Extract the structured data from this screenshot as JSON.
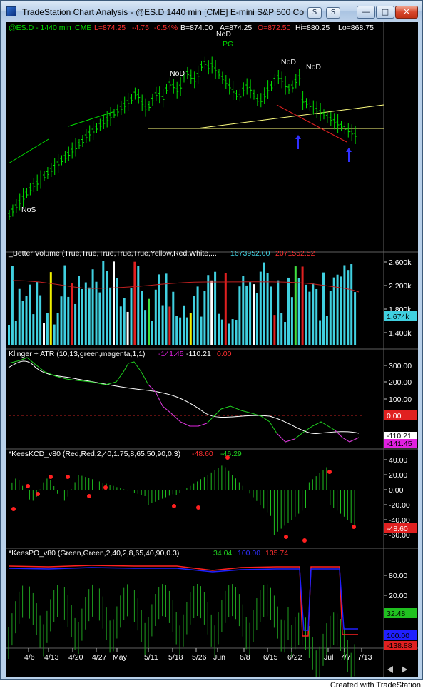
{
  "window": {
    "title": "TradeStation Chart Analysis - @ES.D 1440 min [CME] E-mini S&P 500 Co...",
    "buttons": {
      "s1": "S",
      "s2": "S"
    },
    "caption": {
      "minimize": "—",
      "maximize": "□",
      "close": "✕"
    }
  },
  "status": {
    "credit": "Created with TradeStation"
  },
  "price_panel": {
    "symbol": "@ES.D - 1440 min",
    "exchange": "CME",
    "last": "L=874.25",
    "change": "-4.75",
    "change_pct": "-0.54%",
    "bid": "B=874.00",
    "ask": "A=874.25",
    "open": "O=872.50",
    "high": "Hi=880.25",
    "low": "Lo=868.75",
    "annotations": [
      "NoS",
      "NoD",
      "NoD",
      "PG",
      "NoD",
      "NoD"
    ]
  },
  "volume_panel": {
    "label": "_Better Volume (True,True,True,True,True,Yellow,Red,White,...",
    "value1": "1673952.00",
    "value2": "2071552.52",
    "axis": [
      "2,600k",
      "2,200k",
      "1,800k",
      "1,400k"
    ],
    "current": "1,674k"
  },
  "klinger_panel": {
    "label": "Klinger + ATR (10,13,green,magenta,1,1)",
    "value1": "-141.45",
    "value2": "-110.21",
    "value3": "0.00",
    "axis": [
      "300.00",
      "200.00",
      "100.00"
    ],
    "zero_tag": "0.00",
    "tag1": "-110.21",
    "tag2": "-141.45"
  },
  "kcd_panel": {
    "label": "*KeesKCD_v80 (Red,Red,2,40,1.75,8,65,50,90,0.3)",
    "value1": "-48.60",
    "value2": "-46.29",
    "axis": [
      "40.00",
      "20.00",
      "0.00",
      "-20.00",
      "-40.00",
      "-60.00"
    ],
    "tag": "-48.60"
  },
  "po_panel": {
    "label": "*KeesPO_v80 (Green,Green,2,40,2,8,65,40,90,0.3)",
    "value1": "34.04",
    "value2": "100.00",
    "value3": "135.74",
    "axis": [
      "80.00",
      "20.00"
    ],
    "tag1": "32.48",
    "tag2": "100.00",
    "tag3": "-138.88"
  },
  "x_axis": [
    "4/6",
    "4/13",
    "4/20",
    "4/27",
    "May",
    "5/11",
    "5/18",
    "5/26",
    "Jun",
    "6/8",
    "6/15",
    "6/22",
    "Jul",
    "7/7",
    "7/13"
  ],
  "colors": {
    "bars": "#00e000",
    "volume_main": "#40d0e0",
    "volume_red": "#e02020",
    "volume_white": "#ffffff",
    "volume_yellow": "#f0f000",
    "volume_green": "#40e040",
    "klinger_green": "#20d020",
    "klinger_magenta": "#e020e0",
    "atr_white": "#ffffff",
    "kcd_red": "#ff2020",
    "po_blue": "#2020ff",
    "po_red": "#ff2020",
    "trendline_yellow": "#ffff80",
    "trendline_green": "#00e000",
    "trendline_red": "#e02020"
  }
}
